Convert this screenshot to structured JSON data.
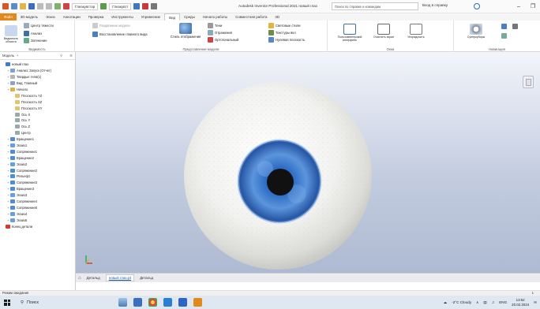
{
  "title_bar": {
    "qat_dropdown_1": "Глизкувгтор",
    "qat_dropdown_2": "Глизкувгт",
    "app_title": "Autodesk Inventor Professional 2021  новый глаз",
    "help_search_placeholder": "Поиск по справке и командам",
    "sign_in": "Вход в справку"
  },
  "tabs": [
    "3D-модель",
    "Эскиз",
    "Аннотации",
    "Проверка",
    "Инструменты",
    "Управление",
    "Вид",
    "Среды",
    "Начало работы",
    "Совместная работа",
    "3D"
  ],
  "file_tab": "Файл",
  "ribbon": {
    "visibility": {
      "cube": "Видимость объекта",
      "item1": "Центр тяжести",
      "item2": "Анализ",
      "item3": "Затенение",
      "label": "Видимость"
    },
    "appearance": {
      "item1": "Раздвоение модели",
      "item2": "Восстановление главного вида",
      "item3": "Стиль отображения",
      "item4": "Тени",
      "item5": "Отражения",
      "item6": "Ортогональный",
      "item7": "Световые стили",
      "item8": "Текстуры вкл",
      "item9": "Нулевая плоскость",
      "label": "Представление модели"
    },
    "windows": {
      "user": "Пользовательский интерфейс",
      "clean": "Очистить экран",
      "arrange": "Упорядочить",
      "label": "Окна"
    },
    "navigate": {
      "steering": "Суперкуборы",
      "label": "Навигация"
    }
  },
  "browser": {
    "header": "Модель",
    "items": [
      {
        "label": "новый глаз",
        "indent": 0,
        "color": "#3a7bd5"
      },
      {
        "label": "Анализ: Запуск (Отчет)",
        "indent": 1,
        "color": "#7aa2d6"
      },
      {
        "label": "Твердые тела(1)",
        "indent": 1,
        "color": "#b5b5b5"
      },
      {
        "label": "Вид: Главный",
        "indent": 1,
        "color": "#8aa4c8"
      },
      {
        "label": "Начало",
        "indent": 1,
        "color": "#e0b040"
      },
      {
        "label": "Плоскость YZ",
        "indent": 2,
        "color": "#e3c46a"
      },
      {
        "label": "Плоскость XZ",
        "indent": 2,
        "color": "#e3c46a"
      },
      {
        "label": "Плоскость XY",
        "indent": 2,
        "color": "#e3c46a"
      },
      {
        "label": "Ось X",
        "indent": 2,
        "color": "#9aa"
      },
      {
        "label": "Ось Y",
        "indent": 2,
        "color": "#9aa"
      },
      {
        "label": "Ось Z",
        "indent": 2,
        "color": "#9aa"
      },
      {
        "label": "Центр",
        "indent": 2,
        "color": "#9aa"
      },
      {
        "label": "Вращение1",
        "indent": 1,
        "color": "#4d8fd0"
      },
      {
        "label": "Эскиз1",
        "indent": 1,
        "color": "#6aa0d8"
      },
      {
        "label": "Сопряжение1",
        "indent": 1,
        "color": "#4d8fd0"
      },
      {
        "label": "Вращение2",
        "indent": 1,
        "color": "#4d8fd0"
      },
      {
        "label": "Эскиз2",
        "indent": 1,
        "color": "#6aa0d8"
      },
      {
        "label": "Сопряжение2",
        "indent": 1,
        "color": "#4d8fd0"
      },
      {
        "label": "Рельеф1",
        "indent": 1,
        "color": "#4d8fd0"
      },
      {
        "label": "Сопряжение3",
        "indent": 1,
        "color": "#4d8fd0"
      },
      {
        "label": "Вращение3",
        "indent": 1,
        "color": "#4d8fd0"
      },
      {
        "label": "Эскиз3",
        "indent": 1,
        "color": "#6aa0d8"
      },
      {
        "label": "Сопряжение4",
        "indent": 1,
        "color": "#4d8fd0"
      },
      {
        "label": "Сопряжение5",
        "indent": 1,
        "color": "#4d8fd0"
      },
      {
        "label": "Эскиз4",
        "indent": 1,
        "color": "#6aa0d8"
      },
      {
        "label": "Эскиз5",
        "indent": 1,
        "color": "#6aa0d8"
      },
      {
        "label": "Конец детали",
        "indent": 0,
        "color": "#d43b2a"
      }
    ]
  },
  "doc_tabs": {
    "home": "Детальд",
    "active": "новый глаз.ipt",
    "other": "Детальд"
  },
  "status_bar": {
    "left": "Режим ожидания",
    "right": "1"
  },
  "taskbar": {
    "search": "Поиск",
    "weather": "-2°C  Cloudy",
    "lang": "ENG",
    "time": "13:52",
    "date": "20.02.2024"
  }
}
